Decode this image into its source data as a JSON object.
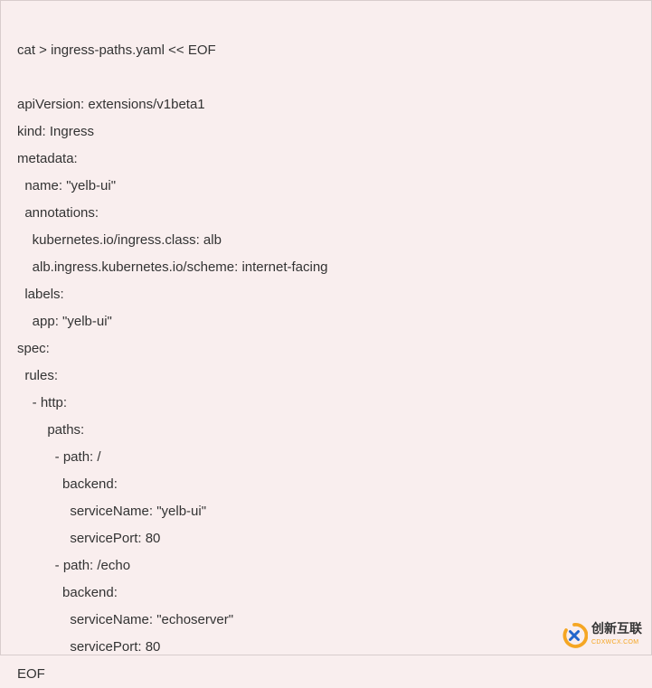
{
  "code": {
    "line1": "cat > ingress-paths.yaml << EOF",
    "line2": "",
    "line3": "apiVersion: extensions/v1beta1",
    "line4": "kind: Ingress",
    "line5": "metadata:",
    "line6": "  name: \"yelb-ui\"",
    "line7": "  annotations:",
    "line8": "    kubernetes.io/ingress.class: alb",
    "line9": "    alb.ingress.kubernetes.io/scheme: internet-facing",
    "line10": "  labels:",
    "line11": "    app: \"yelb-ui\"",
    "line12": "spec:",
    "line13": "  rules:",
    "line14": "    - http:",
    "line15": "        paths:",
    "line16": "          - path: /",
    "line17": "            backend:",
    "line18": "              serviceName: \"yelb-ui\"",
    "line19": "              servicePort: 80",
    "line20": "          - path: /echo",
    "line21": "            backend:",
    "line22": "              serviceName: \"echoserver\"",
    "line23": "              servicePort: 80",
    "line24": "EOF"
  },
  "watermark": {
    "brand": "创新互联",
    "sub": "CDXWCX.COM"
  }
}
